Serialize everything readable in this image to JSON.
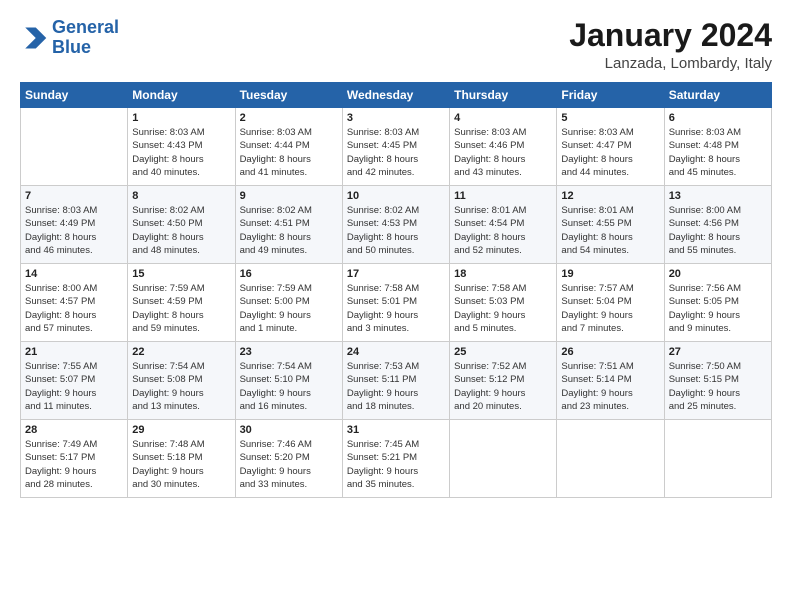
{
  "header": {
    "logo_line1": "General",
    "logo_line2": "Blue",
    "title": "January 2024",
    "subtitle": "Lanzada, Lombardy, Italy"
  },
  "calendar": {
    "days_of_week": [
      "Sunday",
      "Monday",
      "Tuesday",
      "Wednesday",
      "Thursday",
      "Friday",
      "Saturday"
    ],
    "weeks": [
      [
        {
          "day": "",
          "info": ""
        },
        {
          "day": "1",
          "info": "Sunrise: 8:03 AM\nSunset: 4:43 PM\nDaylight: 8 hours\nand 40 minutes."
        },
        {
          "day": "2",
          "info": "Sunrise: 8:03 AM\nSunset: 4:44 PM\nDaylight: 8 hours\nand 41 minutes."
        },
        {
          "day": "3",
          "info": "Sunrise: 8:03 AM\nSunset: 4:45 PM\nDaylight: 8 hours\nand 42 minutes."
        },
        {
          "day": "4",
          "info": "Sunrise: 8:03 AM\nSunset: 4:46 PM\nDaylight: 8 hours\nand 43 minutes."
        },
        {
          "day": "5",
          "info": "Sunrise: 8:03 AM\nSunset: 4:47 PM\nDaylight: 8 hours\nand 44 minutes."
        },
        {
          "day": "6",
          "info": "Sunrise: 8:03 AM\nSunset: 4:48 PM\nDaylight: 8 hours\nand 45 minutes."
        }
      ],
      [
        {
          "day": "7",
          "info": "Sunrise: 8:03 AM\nSunset: 4:49 PM\nDaylight: 8 hours\nand 46 minutes."
        },
        {
          "day": "8",
          "info": "Sunrise: 8:02 AM\nSunset: 4:50 PM\nDaylight: 8 hours\nand 48 minutes."
        },
        {
          "day": "9",
          "info": "Sunrise: 8:02 AM\nSunset: 4:51 PM\nDaylight: 8 hours\nand 49 minutes."
        },
        {
          "day": "10",
          "info": "Sunrise: 8:02 AM\nSunset: 4:53 PM\nDaylight: 8 hours\nand 50 minutes."
        },
        {
          "day": "11",
          "info": "Sunrise: 8:01 AM\nSunset: 4:54 PM\nDaylight: 8 hours\nand 52 minutes."
        },
        {
          "day": "12",
          "info": "Sunrise: 8:01 AM\nSunset: 4:55 PM\nDaylight: 8 hours\nand 54 minutes."
        },
        {
          "day": "13",
          "info": "Sunrise: 8:00 AM\nSunset: 4:56 PM\nDaylight: 8 hours\nand 55 minutes."
        }
      ],
      [
        {
          "day": "14",
          "info": "Sunrise: 8:00 AM\nSunset: 4:57 PM\nDaylight: 8 hours\nand 57 minutes."
        },
        {
          "day": "15",
          "info": "Sunrise: 7:59 AM\nSunset: 4:59 PM\nDaylight: 8 hours\nand 59 minutes."
        },
        {
          "day": "16",
          "info": "Sunrise: 7:59 AM\nSunset: 5:00 PM\nDaylight: 9 hours\nand 1 minute."
        },
        {
          "day": "17",
          "info": "Sunrise: 7:58 AM\nSunset: 5:01 PM\nDaylight: 9 hours\nand 3 minutes."
        },
        {
          "day": "18",
          "info": "Sunrise: 7:58 AM\nSunset: 5:03 PM\nDaylight: 9 hours\nand 5 minutes."
        },
        {
          "day": "19",
          "info": "Sunrise: 7:57 AM\nSunset: 5:04 PM\nDaylight: 9 hours\nand 7 minutes."
        },
        {
          "day": "20",
          "info": "Sunrise: 7:56 AM\nSunset: 5:05 PM\nDaylight: 9 hours\nand 9 minutes."
        }
      ],
      [
        {
          "day": "21",
          "info": "Sunrise: 7:55 AM\nSunset: 5:07 PM\nDaylight: 9 hours\nand 11 minutes."
        },
        {
          "day": "22",
          "info": "Sunrise: 7:54 AM\nSunset: 5:08 PM\nDaylight: 9 hours\nand 13 minutes."
        },
        {
          "day": "23",
          "info": "Sunrise: 7:54 AM\nSunset: 5:10 PM\nDaylight: 9 hours\nand 16 minutes."
        },
        {
          "day": "24",
          "info": "Sunrise: 7:53 AM\nSunset: 5:11 PM\nDaylight: 9 hours\nand 18 minutes."
        },
        {
          "day": "25",
          "info": "Sunrise: 7:52 AM\nSunset: 5:12 PM\nDaylight: 9 hours\nand 20 minutes."
        },
        {
          "day": "26",
          "info": "Sunrise: 7:51 AM\nSunset: 5:14 PM\nDaylight: 9 hours\nand 23 minutes."
        },
        {
          "day": "27",
          "info": "Sunrise: 7:50 AM\nSunset: 5:15 PM\nDaylight: 9 hours\nand 25 minutes."
        }
      ],
      [
        {
          "day": "28",
          "info": "Sunrise: 7:49 AM\nSunset: 5:17 PM\nDaylight: 9 hours\nand 28 minutes."
        },
        {
          "day": "29",
          "info": "Sunrise: 7:48 AM\nSunset: 5:18 PM\nDaylight: 9 hours\nand 30 minutes."
        },
        {
          "day": "30",
          "info": "Sunrise: 7:46 AM\nSunset: 5:20 PM\nDaylight: 9 hours\nand 33 minutes."
        },
        {
          "day": "31",
          "info": "Sunrise: 7:45 AM\nSunset: 5:21 PM\nDaylight: 9 hours\nand 35 minutes."
        },
        {
          "day": "",
          "info": ""
        },
        {
          "day": "",
          "info": ""
        },
        {
          "day": "",
          "info": ""
        }
      ]
    ]
  }
}
